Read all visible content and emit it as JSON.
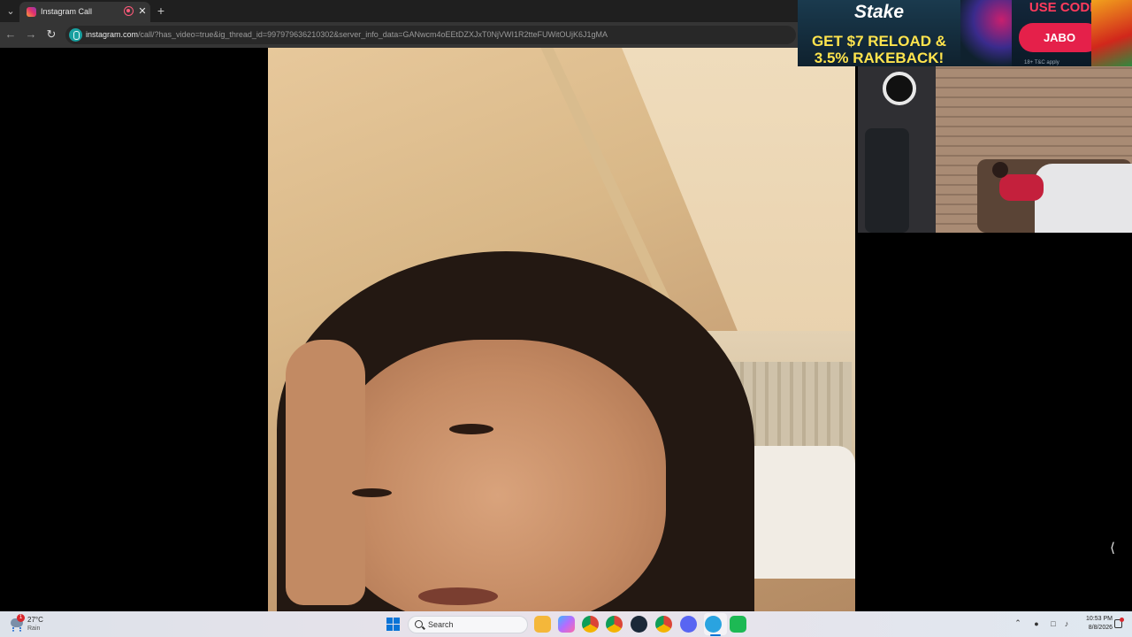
{
  "browser": {
    "tab_title": "Instagram Call",
    "url_host": "instagram.com",
    "url_path": "/call/?has_video=true&ig_thread_id=997979636210302&server_info_data=GANwcm4oEEtDZXJxT0NjVWI1R2tteFUWitOUjK6J1gMA"
  },
  "ad": {
    "logo": "Stake",
    "headline_line1": "GET $7 RELOAD &",
    "headline_line2": "3.5% RAKEBACK!",
    "use_code_label": "USE CODE",
    "code": "JABO",
    "terms": "18+ T&C apply"
  },
  "taskbar": {
    "weather_temp": "27°C",
    "weather_desc": "Rain",
    "weather_badge": "1",
    "search_label": "Search",
    "clock_time": "10:53 PM",
    "clock_date": "8/8/2026"
  },
  "colors": {
    "accent": "#0a74d6",
    "ad_code_button": "#e5204a",
    "ad_headline": "#ffe44d"
  }
}
